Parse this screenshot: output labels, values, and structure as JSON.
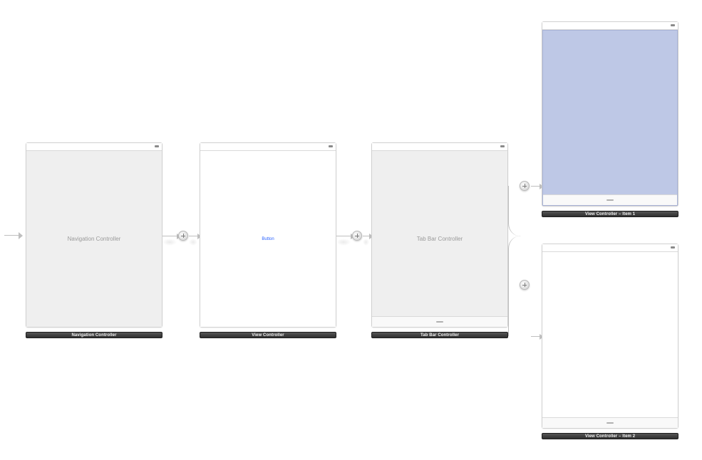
{
  "scenes": {
    "nav": {
      "placeholder": "Navigation Controller",
      "caption": "Navigation Controller"
    },
    "vc": {
      "button_label": "Button",
      "caption": "View Controller"
    },
    "tabbar": {
      "placeholder": "Tab Bar Controller",
      "caption": "Tab Bar Controller"
    },
    "item1": {
      "caption": "View Controller – Item 1"
    },
    "item2": {
      "caption": "View Controller – Item 2"
    }
  }
}
